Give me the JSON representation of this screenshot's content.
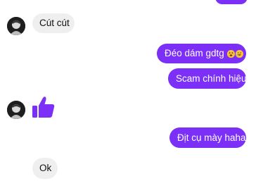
{
  "conversation": {
    "accent_color": "#7b2ff7",
    "incoming_color": "#efefef",
    "messages": [
      {
        "side": "incoming",
        "text": "Cút cút"
      },
      {
        "side": "outgoing",
        "text": "Đéo dám gdtg",
        "emojis": [
          "weary-face-emoji",
          "rolling-on-floor-laughing-emoji"
        ]
      },
      {
        "side": "outgoing",
        "text": "Scam chính hiệu"
      },
      {
        "side": "incoming",
        "type": "like",
        "icon": "thumbs-up-icon"
      },
      {
        "side": "outgoing",
        "text": "Địt cụ mày haha"
      },
      {
        "side": "incoming",
        "text": "Ok"
      }
    ]
  }
}
